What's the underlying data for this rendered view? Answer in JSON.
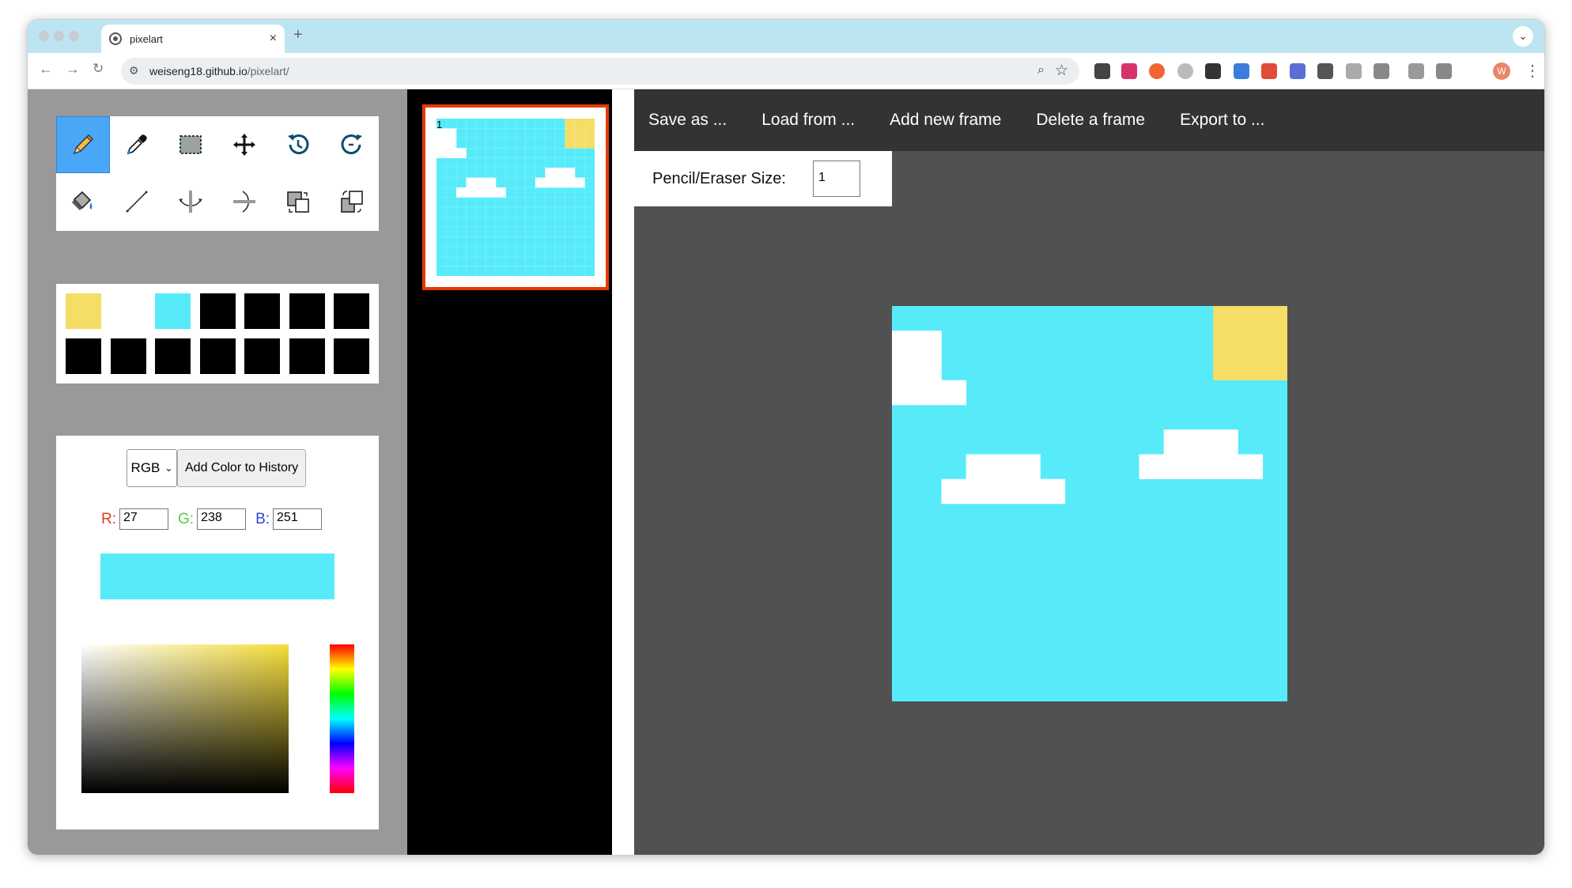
{
  "browser": {
    "tab_title": "pixelart",
    "new_tab": "+",
    "tab_close": "×",
    "tab_menu": "⌄",
    "url_host": "weiseng18.github.io",
    "url_path": "/pixelart/",
    "profile_initial": "W"
  },
  "tools": {
    "items": [
      "pencil",
      "eyedropper",
      "select",
      "move",
      "undo",
      "redo",
      "fill",
      "line",
      "flip-vertical",
      "flip-horizontal",
      "copy-paste",
      "rotate"
    ],
    "active": "pencil"
  },
  "palette": {
    "colors": [
      "#f5dd66",
      "#ffffff",
      "#57ebfa",
      "#000000",
      "#000000",
      "#000000",
      "#000000",
      "#000000",
      "#000000",
      "#000000",
      "#000000",
      "#000000",
      "#000000",
      "#000000"
    ]
  },
  "color_picker": {
    "mode": "RGB",
    "add_button": "Add Color to History",
    "r_label": "R:",
    "g_label": "G:",
    "b_label": "B:",
    "r": "27",
    "g": "238",
    "b": "251",
    "preview_color": "#57ebfa",
    "hue_base": "#f5dd3a"
  },
  "frames": [
    {
      "number": "1",
      "selected": true
    }
  ],
  "menu": {
    "save": "Save as ...",
    "load": "Load from ...",
    "add": "Add new frame",
    "delete": "Delete a frame",
    "export": "Export to ..."
  },
  "pencil_size": {
    "label": "Pencil/Eraser Size:",
    "value": "1"
  },
  "art": {
    "grid_size": 16,
    "sky_color": "#57ebfa",
    "sun_color": "#f5dd66",
    "cloud_color": "#ffffff",
    "sun_cells": [
      [
        13,
        0
      ],
      [
        14,
        0
      ],
      [
        15,
        0
      ],
      [
        13,
        1
      ],
      [
        14,
        1
      ],
      [
        15,
        1
      ],
      [
        13,
        2
      ],
      [
        14,
        2
      ],
      [
        15,
        2
      ]
    ],
    "cloud_cells": [
      [
        0,
        1
      ],
      [
        0,
        2
      ],
      [
        1,
        1
      ],
      [
        1,
        2
      ],
      [
        1,
        3
      ],
      [
        2,
        3
      ],
      [
        0,
        3
      ],
      [
        3,
        6
      ],
      [
        4,
        6
      ],
      [
        5,
        6
      ],
      [
        2,
        7
      ],
      [
        3,
        7
      ],
      [
        4,
        7
      ],
      [
        5,
        7
      ],
      [
        6,
        7
      ],
      [
        11,
        5
      ],
      [
        12,
        5
      ],
      [
        13,
        5
      ],
      [
        10,
        6
      ],
      [
        11,
        6
      ],
      [
        12,
        6
      ],
      [
        13,
        6
      ],
      [
        14,
        6
      ]
    ]
  },
  "colors": {
    "active_tool": "#4aa6f7",
    "frame_border": "#e63900",
    "menubar_bg": "#333333",
    "canvas_bg": "#515151"
  }
}
